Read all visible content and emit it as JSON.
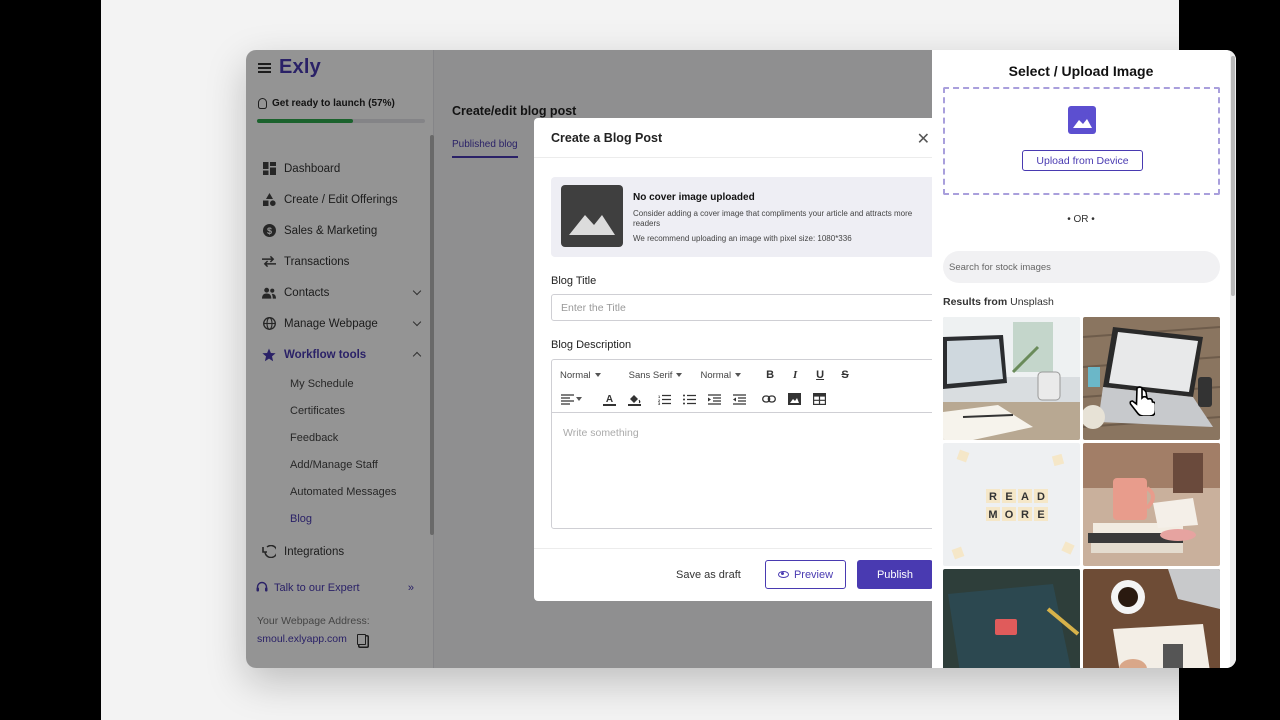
{
  "app": {
    "logo": "Exly",
    "launch_text": "Get ready to launch (57%)",
    "launch_progress": 0.57
  },
  "sidebar": {
    "items": [
      {
        "label": "Dashboard",
        "icon": "dashboard-icon"
      },
      {
        "label": "Create / Edit Offerings",
        "icon": "offerings-icon"
      },
      {
        "label": "Sales & Marketing",
        "icon": "dollar-icon"
      },
      {
        "label": "Transactions",
        "icon": "transfer-icon"
      },
      {
        "label": "Contacts",
        "icon": "people-icon",
        "expandable": true
      },
      {
        "label": "Manage Webpage",
        "icon": "globe-icon",
        "expandable": true
      },
      {
        "label": "Workflow tools",
        "icon": "star-icon",
        "expanded": true,
        "active": true
      }
    ],
    "subitems": [
      "My Schedule",
      "Certificates",
      "Feedback",
      "Add/Manage Staff",
      "Automated Messages",
      "Blog"
    ],
    "integrations": "Integrations",
    "expert": "Talk to our Expert",
    "address_label": "Your Webpage Address:",
    "address": "smoul.exlyapp.com"
  },
  "page": {
    "title": "Create/edit blog post",
    "tab": "Published blog"
  },
  "modal": {
    "title": "Create a Blog Post",
    "cover": {
      "title": "No cover image uploaded",
      "desc": "Consider adding a cover image that compliments your article and attracts more readers",
      "hint": "We recommend uploading an image with pixel size: 1080*336"
    },
    "blog_title_label": "Blog Title",
    "blog_title_placeholder": "Enter the Title",
    "blog_desc_label": "Blog Description",
    "toolbar": {
      "heading": "Normal",
      "font": "Sans Serif",
      "size": "Normal"
    },
    "editor_placeholder": "Write something",
    "save_draft": "Save as draft",
    "preview": "Preview",
    "publish": "Publish"
  },
  "panel": {
    "title": "Select / Upload Image",
    "upload_button": "Upload from Device",
    "or": "• OR •",
    "search_placeholder": "Search for stock images",
    "results_prefix": "Results from",
    "results_source": "Unsplash",
    "images": [
      "laptop-desk-photo",
      "laptop-wood-table-photo",
      "read-more-letters-photo",
      "pink-mug-books-photo",
      "notebook-pen-photo",
      "coffee-laptop-desk-photo"
    ]
  },
  "colors": {
    "accent": "#493ab1",
    "progress": "#2faa4e"
  }
}
